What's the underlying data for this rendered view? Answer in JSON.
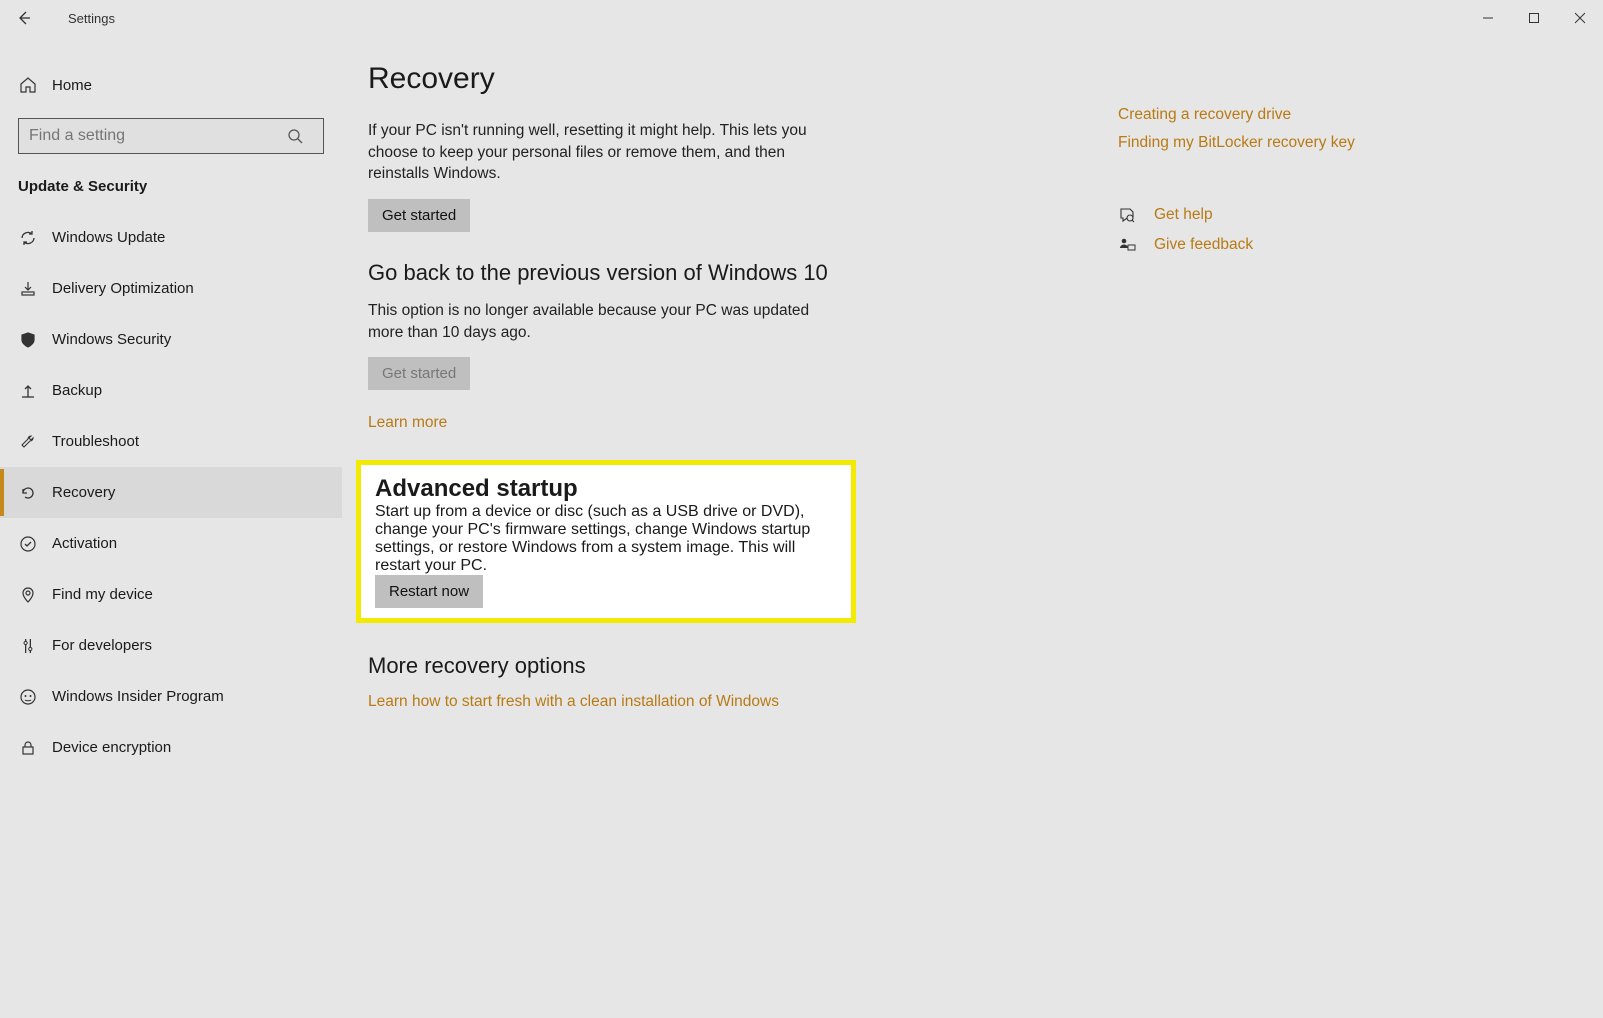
{
  "window": {
    "title": "Settings"
  },
  "sidebar": {
    "home": "Home",
    "search_placeholder": "Find a setting",
    "section_header": "Update & Security",
    "items": [
      {
        "label": "Windows Update"
      },
      {
        "label": "Delivery Optimization"
      },
      {
        "label": "Windows Security"
      },
      {
        "label": "Backup"
      },
      {
        "label": "Troubleshoot"
      },
      {
        "label": "Recovery"
      },
      {
        "label": "Activation"
      },
      {
        "label": "Find my device"
      },
      {
        "label": "For developers"
      },
      {
        "label": "Windows Insider Program"
      },
      {
        "label": "Device encryption"
      }
    ]
  },
  "page": {
    "title": "Recovery",
    "reset": {
      "desc": "If your PC isn't running well, resetting it might help. This lets you choose to keep your personal files or remove them, and then reinstalls Windows.",
      "button": "Get started"
    },
    "goback": {
      "heading": "Go back to the previous version of Windows 10",
      "desc": "This option is no longer available because your PC was updated more than 10 days ago.",
      "button": "Get started",
      "learn_more": "Learn more"
    },
    "advanced": {
      "heading": "Advanced startup",
      "desc": "Start up from a device or disc (such as a USB drive or DVD), change your PC's firmware settings, change Windows startup settings, or restore Windows from a system image. This will restart your PC.",
      "button": "Restart now"
    },
    "more": {
      "heading": "More recovery options",
      "link": "Learn how to start fresh with a clean installation of Windows"
    }
  },
  "aside": {
    "links": [
      "Creating a recovery drive",
      "Finding my BitLocker recovery key"
    ],
    "help": "Get help",
    "feedback": "Give feedback"
  },
  "colors": {
    "accent": "#b87a14"
  }
}
